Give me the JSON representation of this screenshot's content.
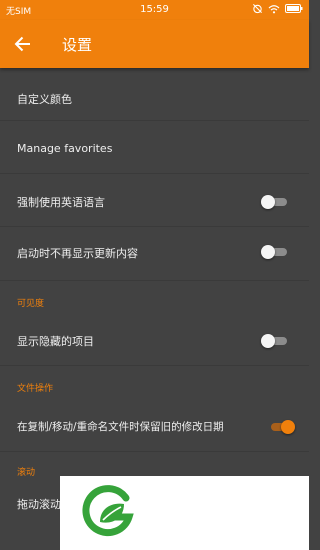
{
  "status_bar": {
    "carrier": "无SIM",
    "time": "15:59"
  },
  "app_bar": {
    "title": "设置"
  },
  "items": {
    "custom_colors": {
      "label": "自定义颜色"
    },
    "manage_favorites": {
      "label": "Manage favorites"
    },
    "force_english": {
      "label": "强制使用英语语言",
      "enabled": false
    },
    "hide_whats_new": {
      "label": "启动时不再显示更新内容",
      "enabled": false
    },
    "show_hidden": {
      "label": "显示隐藏的项目",
      "enabled": false
    },
    "keep_modified_date": {
      "label": "在复制/移动/重命名文件时保留旧的修改日期",
      "enabled": true
    },
    "drag_scroll": {
      "label": "拖动滚动"
    }
  },
  "sections": {
    "visibility": "可见度",
    "file_operations": "文件操作",
    "scrolling": "滚动"
  },
  "colors": {
    "accent": "#f0800c",
    "background": "#424242",
    "text": "#eeeeee"
  }
}
